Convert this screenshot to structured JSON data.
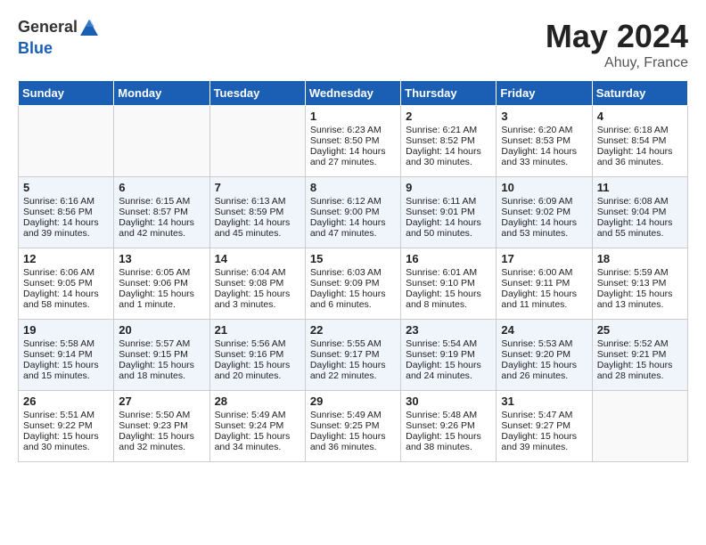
{
  "header": {
    "logo_general": "General",
    "logo_blue": "Blue",
    "month": "May 2024",
    "location": "Ahuy, France"
  },
  "days_of_week": [
    "Sunday",
    "Monday",
    "Tuesday",
    "Wednesday",
    "Thursday",
    "Friday",
    "Saturday"
  ],
  "weeks": [
    {
      "days": [
        {
          "num": "",
          "info": []
        },
        {
          "num": "",
          "info": []
        },
        {
          "num": "",
          "info": []
        },
        {
          "num": "1",
          "info": [
            "Sunrise: 6:23 AM",
            "Sunset: 8:50 PM",
            "Daylight: 14 hours",
            "and 27 minutes."
          ]
        },
        {
          "num": "2",
          "info": [
            "Sunrise: 6:21 AM",
            "Sunset: 8:52 PM",
            "Daylight: 14 hours",
            "and 30 minutes."
          ]
        },
        {
          "num": "3",
          "info": [
            "Sunrise: 6:20 AM",
            "Sunset: 8:53 PM",
            "Daylight: 14 hours",
            "and 33 minutes."
          ]
        },
        {
          "num": "4",
          "info": [
            "Sunrise: 6:18 AM",
            "Sunset: 8:54 PM",
            "Daylight: 14 hours",
            "and 36 minutes."
          ]
        }
      ]
    },
    {
      "days": [
        {
          "num": "5",
          "info": [
            "Sunrise: 6:16 AM",
            "Sunset: 8:56 PM",
            "Daylight: 14 hours",
            "and 39 minutes."
          ]
        },
        {
          "num": "6",
          "info": [
            "Sunrise: 6:15 AM",
            "Sunset: 8:57 PM",
            "Daylight: 14 hours",
            "and 42 minutes."
          ]
        },
        {
          "num": "7",
          "info": [
            "Sunrise: 6:13 AM",
            "Sunset: 8:59 PM",
            "Daylight: 14 hours",
            "and 45 minutes."
          ]
        },
        {
          "num": "8",
          "info": [
            "Sunrise: 6:12 AM",
            "Sunset: 9:00 PM",
            "Daylight: 14 hours",
            "and 47 minutes."
          ]
        },
        {
          "num": "9",
          "info": [
            "Sunrise: 6:11 AM",
            "Sunset: 9:01 PM",
            "Daylight: 14 hours",
            "and 50 minutes."
          ]
        },
        {
          "num": "10",
          "info": [
            "Sunrise: 6:09 AM",
            "Sunset: 9:02 PM",
            "Daylight: 14 hours",
            "and 53 minutes."
          ]
        },
        {
          "num": "11",
          "info": [
            "Sunrise: 6:08 AM",
            "Sunset: 9:04 PM",
            "Daylight: 14 hours",
            "and 55 minutes."
          ]
        }
      ]
    },
    {
      "days": [
        {
          "num": "12",
          "info": [
            "Sunrise: 6:06 AM",
            "Sunset: 9:05 PM",
            "Daylight: 14 hours",
            "and 58 minutes."
          ]
        },
        {
          "num": "13",
          "info": [
            "Sunrise: 6:05 AM",
            "Sunset: 9:06 PM",
            "Daylight: 15 hours",
            "and 1 minute."
          ]
        },
        {
          "num": "14",
          "info": [
            "Sunrise: 6:04 AM",
            "Sunset: 9:08 PM",
            "Daylight: 15 hours",
            "and 3 minutes."
          ]
        },
        {
          "num": "15",
          "info": [
            "Sunrise: 6:03 AM",
            "Sunset: 9:09 PM",
            "Daylight: 15 hours",
            "and 6 minutes."
          ]
        },
        {
          "num": "16",
          "info": [
            "Sunrise: 6:01 AM",
            "Sunset: 9:10 PM",
            "Daylight: 15 hours",
            "and 8 minutes."
          ]
        },
        {
          "num": "17",
          "info": [
            "Sunrise: 6:00 AM",
            "Sunset: 9:11 PM",
            "Daylight: 15 hours",
            "and 11 minutes."
          ]
        },
        {
          "num": "18",
          "info": [
            "Sunrise: 5:59 AM",
            "Sunset: 9:13 PM",
            "Daylight: 15 hours",
            "and 13 minutes."
          ]
        }
      ]
    },
    {
      "days": [
        {
          "num": "19",
          "info": [
            "Sunrise: 5:58 AM",
            "Sunset: 9:14 PM",
            "Daylight: 15 hours",
            "and 15 minutes."
          ]
        },
        {
          "num": "20",
          "info": [
            "Sunrise: 5:57 AM",
            "Sunset: 9:15 PM",
            "Daylight: 15 hours",
            "and 18 minutes."
          ]
        },
        {
          "num": "21",
          "info": [
            "Sunrise: 5:56 AM",
            "Sunset: 9:16 PM",
            "Daylight: 15 hours",
            "and 20 minutes."
          ]
        },
        {
          "num": "22",
          "info": [
            "Sunrise: 5:55 AM",
            "Sunset: 9:17 PM",
            "Daylight: 15 hours",
            "and 22 minutes."
          ]
        },
        {
          "num": "23",
          "info": [
            "Sunrise: 5:54 AM",
            "Sunset: 9:19 PM",
            "Daylight: 15 hours",
            "and 24 minutes."
          ]
        },
        {
          "num": "24",
          "info": [
            "Sunrise: 5:53 AM",
            "Sunset: 9:20 PM",
            "Daylight: 15 hours",
            "and 26 minutes."
          ]
        },
        {
          "num": "25",
          "info": [
            "Sunrise: 5:52 AM",
            "Sunset: 9:21 PM",
            "Daylight: 15 hours",
            "and 28 minutes."
          ]
        }
      ]
    },
    {
      "days": [
        {
          "num": "26",
          "info": [
            "Sunrise: 5:51 AM",
            "Sunset: 9:22 PM",
            "Daylight: 15 hours",
            "and 30 minutes."
          ]
        },
        {
          "num": "27",
          "info": [
            "Sunrise: 5:50 AM",
            "Sunset: 9:23 PM",
            "Daylight: 15 hours",
            "and 32 minutes."
          ]
        },
        {
          "num": "28",
          "info": [
            "Sunrise: 5:49 AM",
            "Sunset: 9:24 PM",
            "Daylight: 15 hours",
            "and 34 minutes."
          ]
        },
        {
          "num": "29",
          "info": [
            "Sunrise: 5:49 AM",
            "Sunset: 9:25 PM",
            "Daylight: 15 hours",
            "and 36 minutes."
          ]
        },
        {
          "num": "30",
          "info": [
            "Sunrise: 5:48 AM",
            "Sunset: 9:26 PM",
            "Daylight: 15 hours",
            "and 38 minutes."
          ]
        },
        {
          "num": "31",
          "info": [
            "Sunrise: 5:47 AM",
            "Sunset: 9:27 PM",
            "Daylight: 15 hours",
            "and 39 minutes."
          ]
        },
        {
          "num": "",
          "info": []
        }
      ]
    }
  ]
}
